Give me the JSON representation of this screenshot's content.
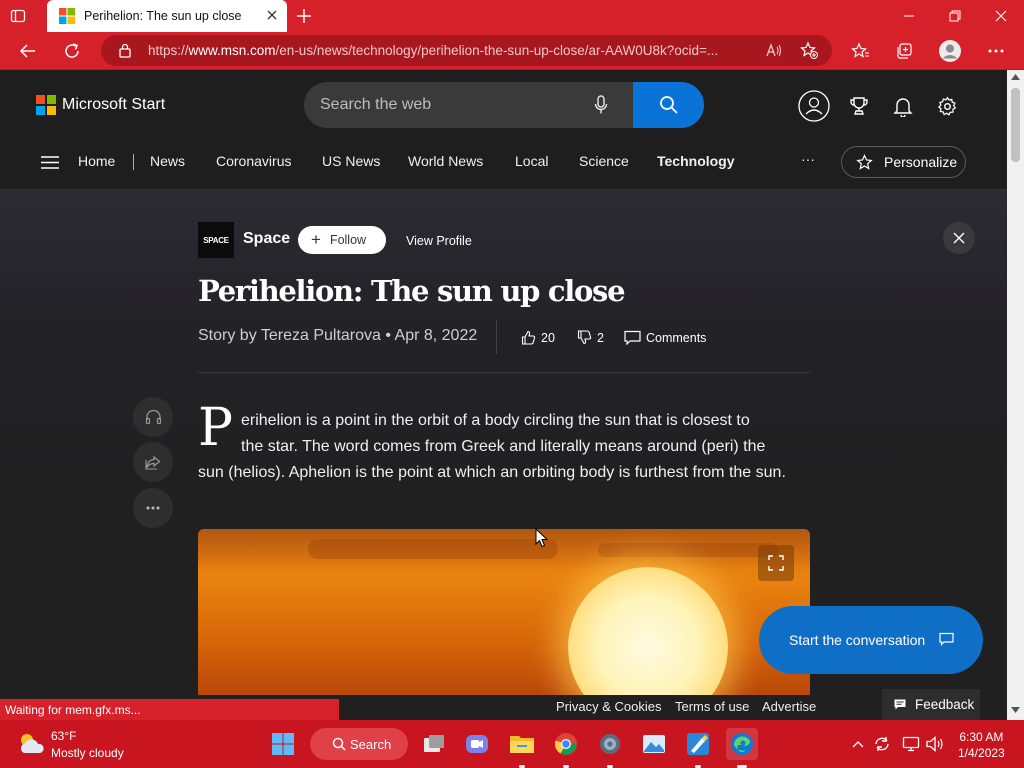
{
  "browser": {
    "tab_title": "Perihelion: The sun up close",
    "url_prefix": "https://",
    "url_domain": "www.msn.com",
    "url_path": "/en-us/news/technology/perihelion-the-sun-up-close/ar-AAW0U8k?ocid=..."
  },
  "msn": {
    "brand": "Microsoft Start",
    "search_placeholder": "Search the web",
    "nav": [
      "Home",
      "News",
      "Coronavirus",
      "US News",
      "World News",
      "Local",
      "Science",
      "Technology"
    ],
    "nav_active": "Technology",
    "more": "···",
    "personalize": "Personalize"
  },
  "article": {
    "publisher": "Space",
    "publisher_logo_text": "SPACE",
    "follow": "Follow",
    "view_profile": "View Profile",
    "headline": "Perihelion: The sun up close",
    "byline": "Story by Tereza Pultarova • Apr 8, 2022",
    "likes": "20",
    "dislikes": "2",
    "comments": "Comments",
    "dropcap": "P",
    "para_line1": "erihelion is a point in the orbit of a body circling the sun that is closest to",
    "para_line2": "the star. The word comes from Greek and literally means around (peri) the",
    "para_rest": "sun (helios). Aphelion is the point at which an orbiting body is furthest from the sun."
  },
  "conversation": "Start the conversation",
  "footer": {
    "status": "Waiting for mem.gfx.ms...",
    "privacy": "Privacy & Cookies",
    "terms": "Terms of use",
    "advertise": "Advertise",
    "feedback": "Feedback"
  },
  "taskbar": {
    "temp": "63°F",
    "condition": "Mostly cloudy",
    "search": "Search",
    "time": "6:30 AM",
    "date": "1/4/2023"
  },
  "colors": {
    "accent_red": "#d6202a",
    "msn_blue": "#0a73d8"
  }
}
